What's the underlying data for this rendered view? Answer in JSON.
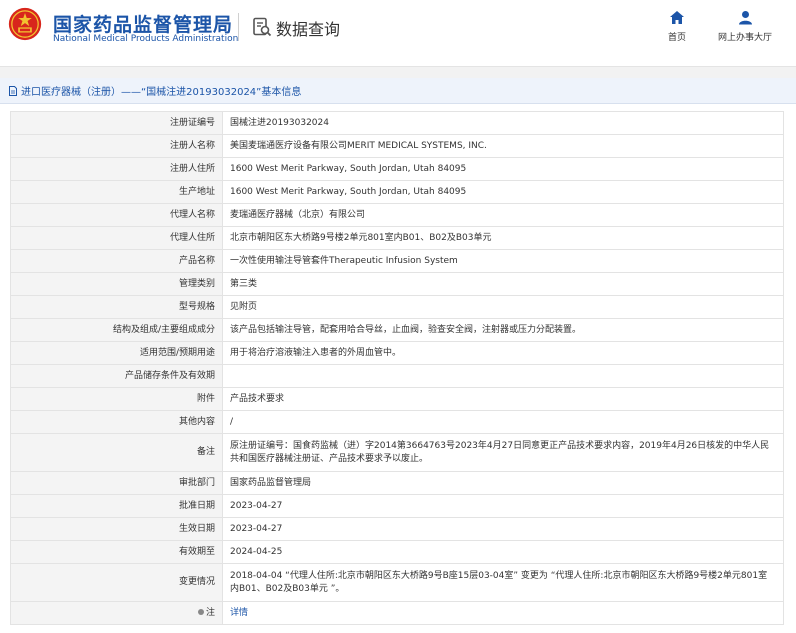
{
  "header": {
    "org_name_cn": "国家药品监督管理局",
    "org_name_en": "National Medical Products Administration",
    "section_title": "数据查询",
    "nav": {
      "home": "首页",
      "service_hall": "网上办事大厅"
    }
  },
  "page": {
    "title": "进口医疗器械（注册）——“国械注进20193032024”基本信息"
  },
  "record": {
    "rows": [
      {
        "label": "注册证编号",
        "value": "国械注进20193032024"
      },
      {
        "label": "注册人名称",
        "value": "美国麦瑞通医疗设备有限公司MERIT MEDICAL SYSTEMS, INC."
      },
      {
        "label": "注册人住所",
        "value": "1600 West Merit Parkway, South Jordan, Utah 84095"
      },
      {
        "label": "生产地址",
        "value": "1600 West Merit Parkway, South Jordan, Utah 84095"
      },
      {
        "label": "代理人名称",
        "value": "麦瑞通医疗器械（北京）有限公司"
      },
      {
        "label": "代理人住所",
        "value": "北京市朝阳区东大桥路9号楼2单元801室内B01、B02及B03单元"
      },
      {
        "label": "产品名称",
        "value": "一次性使用输注导管套件Therapeutic Infusion System"
      },
      {
        "label": "管理类别",
        "value": "第三类"
      },
      {
        "label": "型号规格",
        "value": "见附页"
      },
      {
        "label": "结构及组成/主要组成成分",
        "value": "该产品包括输注导管，配套用哈合导丝，止血阀，验查安全阀，注射器或压力分配装置。"
      },
      {
        "label": "适用范围/预期用途",
        "value": "用于将治疗溶液输注入患者的外周血管中。"
      },
      {
        "label": "产品储存条件及有效期",
        "value": ""
      },
      {
        "label": "附件",
        "value": "产品技术要求"
      },
      {
        "label": "其他内容",
        "value": "/"
      },
      {
        "label": "备注",
        "value": "原注册证编号：国食药监械（进）字2014第3664763号2023年4月27日同意更正产品技术要求内容，2019年4月26日核发的中华人民共和国医疗器械注册证、产品技术要求予以废止。"
      },
      {
        "label": "审批部门",
        "value": "国家药品监督管理局"
      },
      {
        "label": "批准日期",
        "value": "2023-04-27"
      },
      {
        "label": "生效日期",
        "value": "2023-04-27"
      },
      {
        "label": "有效期至",
        "value": "2024-04-25"
      },
      {
        "label": "变更情况",
        "value": "2018-04-04 “代理人住所:北京市朝阳区东大桥路9号B座15层03-04室” 变更为 “代理人住所:北京市朝阳区东大桥路9号楼2单元801室内B01、B02及B03单元 ”。"
      }
    ],
    "note_row": {
      "label": "注",
      "value": "详情"
    }
  },
  "colors": {
    "brand_blue": "#1c55a8",
    "emblem_red": "#d8261c",
    "emblem_gold": "#f2c230",
    "label_bg": "#f4f4f4",
    "border": "#e3e3e3"
  },
  "icons": {
    "emblem": "national-emblem-icon",
    "query": "data-query-icon",
    "home": "home-icon",
    "service_hall": "user-icon",
    "title": "document-icon",
    "note": "location-pin-icon"
  }
}
